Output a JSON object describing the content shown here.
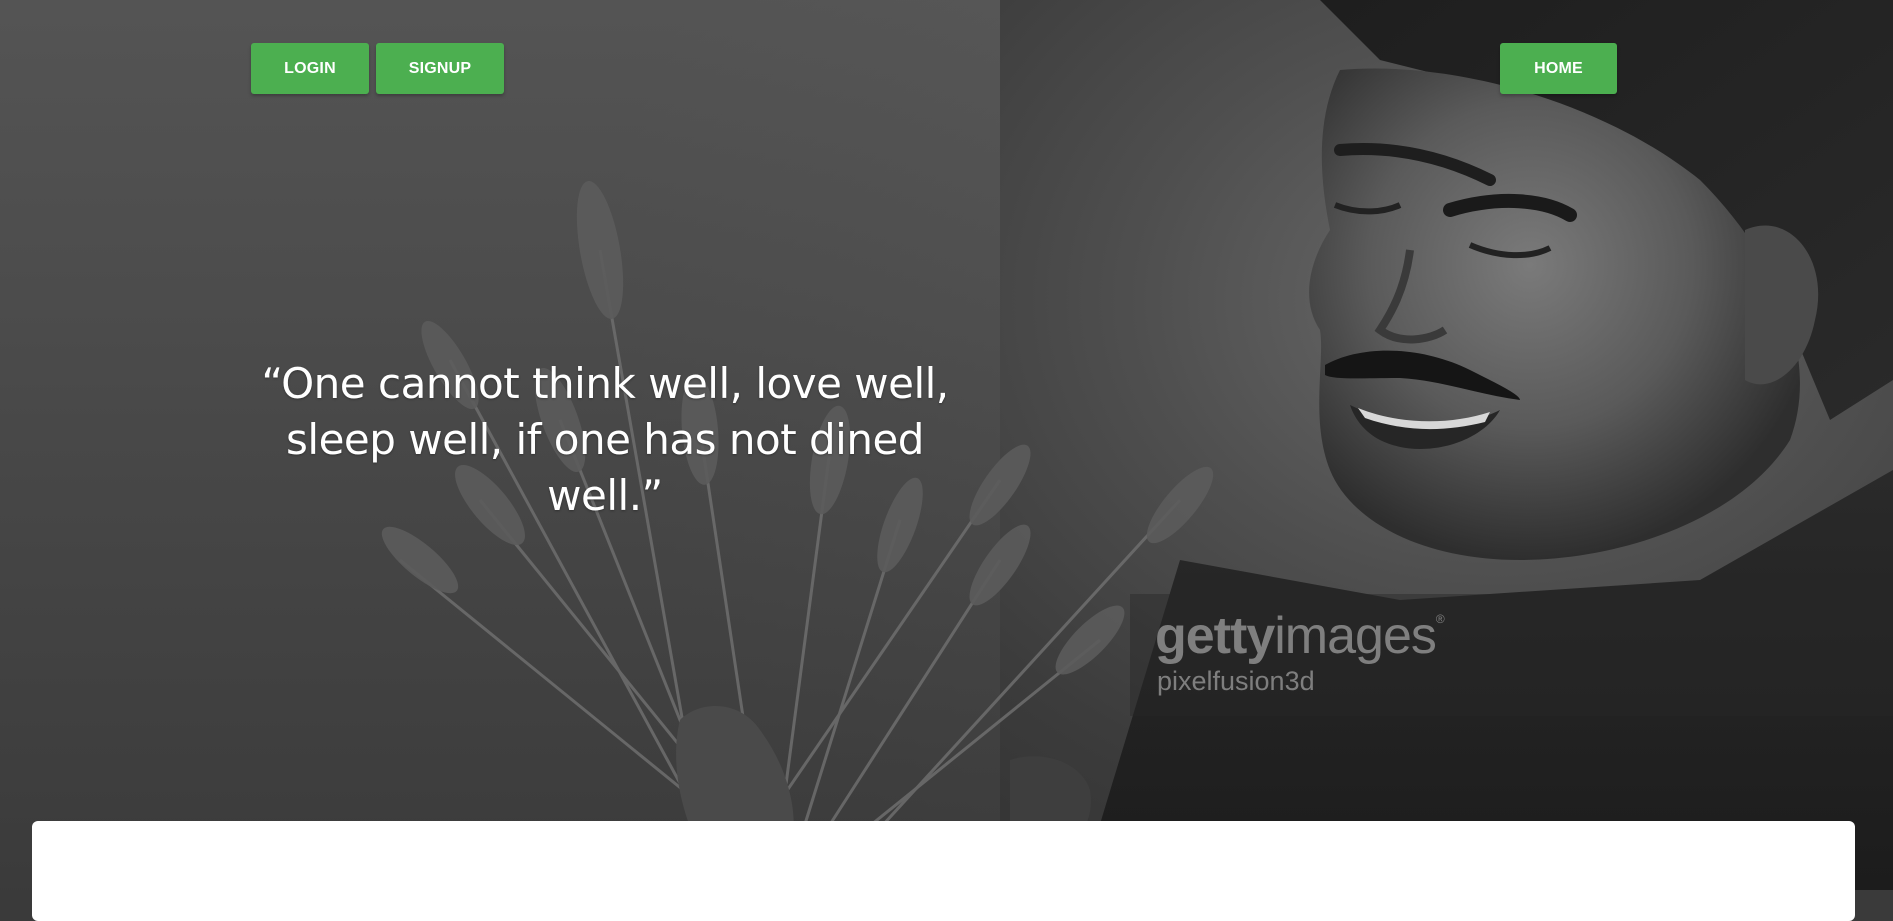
{
  "nav": {
    "login_label": "LOGIN",
    "signup_label": "SIGNUP",
    "home_label": "HOME"
  },
  "hero": {
    "quote_line1": "“One cannot think well, love well,",
    "quote_line2": "sleep well, if one has not dined well.”",
    "watermark_brand_bold": "getty",
    "watermark_brand_light": "images",
    "watermark_registered": "®",
    "watermark_credit": "pixelfusion3d"
  },
  "colors": {
    "accent": "#4caf50",
    "text_light": "#ffffff",
    "card_bg": "#ffffff"
  }
}
